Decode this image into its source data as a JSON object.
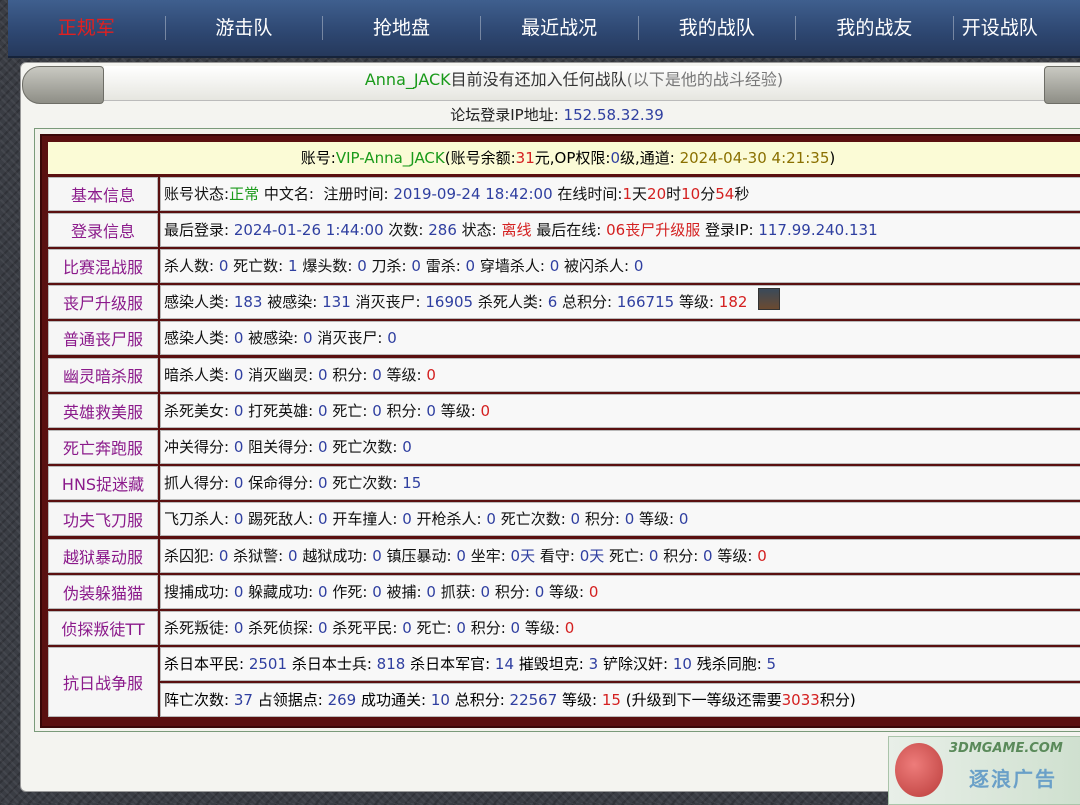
{
  "nav": [
    {
      "label": "正规军",
      "active": true
    },
    {
      "label": "游击队"
    },
    {
      "label": "抢地盘"
    },
    {
      "label": "最近战况"
    },
    {
      "label": "我的战队"
    },
    {
      "label": "我的战友"
    },
    {
      "label": "开设战队"
    }
  ],
  "header": {
    "name": "Anna_JACK",
    "msg": "目前没有还加入任何战队",
    "note": "(以下是他的战斗经验)"
  },
  "ip": {
    "label": "论坛登录IP地址:",
    "value": "152.58.32.39"
  },
  "account": {
    "label": "账号:",
    "value": "VIP-Anna_JACK",
    "bal_label": "(账号余额:",
    "balance": "31",
    "bal_unit": "元,OP权限:",
    "op": "0",
    "op_unit": "级,通道:",
    "date": "2024-04-30 4:21:35",
    "close": ")"
  },
  "basic": {
    "label": "基本信息",
    "status_label": "账号状态:",
    "status": "正常",
    "cname_label": "中文名:",
    "reg_label": "注册时间:",
    "reg": "2019-09-24 18:42:00",
    "online_label": "在线时间:",
    "d": "1",
    "d_u": "天",
    "h": "20",
    "h_u": "时",
    "m": "10",
    "m_u": "分",
    "s": "54",
    "s_u": "秒"
  },
  "login": {
    "label": "登录信息",
    "last_label": "最后登录:",
    "last": "2024-01-26 1:44:00",
    "count_label": "次数:",
    "count": "286",
    "state_label": "状态:",
    "state": "离线",
    "lastsrv_label": "最后在线:",
    "lastsrv": "06丧尸升级服",
    "ip_label": "登录IP:",
    "ip": "117.99.240.131"
  },
  "rows": [
    {
      "label": "比赛混战服",
      "items": [
        [
          "杀人数:",
          "0"
        ],
        [
          "死亡数:",
          "1"
        ],
        [
          "爆头数:",
          "0"
        ],
        [
          "刀杀:",
          "0"
        ],
        [
          "雷杀:",
          "0"
        ],
        [
          "穿墙杀人:",
          "0"
        ],
        [
          "被闪杀人:",
          "0"
        ]
      ]
    },
    {
      "label": "丧尸升级服",
      "items": [
        [
          "感染人类:",
          "183"
        ],
        [
          "被感染:",
          "131"
        ],
        [
          "消灭丧尸:",
          "16905"
        ],
        [
          "杀死人类:",
          "6"
        ],
        [
          "总积分:",
          "166715"
        ],
        [
          "等级:",
          "182",
          "red"
        ]
      ],
      "avatar": true
    },
    {
      "label": "普通丧尸服",
      "items": [
        [
          "感染人类:",
          "0"
        ],
        [
          "被感染:",
          "0"
        ],
        [
          "消灭丧尸:",
          "0"
        ]
      ]
    },
    {
      "label": "幽灵暗杀服",
      "items": [
        [
          "暗杀人类:",
          "0"
        ],
        [
          "消灭幽灵:",
          "0"
        ],
        [
          "积分:",
          "0"
        ],
        [
          "等级:",
          "0",
          "red"
        ]
      ]
    },
    {
      "label": "英雄救美服",
      "items": [
        [
          "杀死美女:",
          "0"
        ],
        [
          "打死英雄:",
          "0"
        ],
        [
          "死亡:",
          "0"
        ],
        [
          "积分:",
          "0"
        ],
        [
          "等级:",
          "0",
          "red"
        ]
      ]
    },
    {
      "label": "死亡奔跑服",
      "items": [
        [
          "冲关得分:",
          "0"
        ],
        [
          "阻关得分:",
          "0"
        ],
        [
          "死亡次数:",
          "0"
        ]
      ]
    },
    {
      "label": "HNS捉迷藏",
      "items": [
        [
          "抓人得分:",
          "0"
        ],
        [
          "保命得分:",
          "0"
        ],
        [
          "死亡次数:",
          "15"
        ]
      ]
    },
    {
      "label": "功夫飞刀服",
      "items": [
        [
          "飞刀杀人:",
          "0"
        ],
        [
          "踢死敌人:",
          "0"
        ],
        [
          "开车撞人:",
          "0"
        ],
        [
          "开枪杀人:",
          "0"
        ],
        [
          "死亡次数:",
          "0"
        ],
        [
          "积分:",
          "0"
        ],
        [
          "等级:",
          "0"
        ]
      ]
    },
    {
      "label": "越狱暴动服",
      "items": [
        [
          "杀囚犯:",
          "0"
        ],
        [
          "杀狱警:",
          "0"
        ],
        [
          "越狱成功:",
          "0"
        ],
        [
          "镇压暴动:",
          "0"
        ],
        [
          "坐牢:",
          "0天"
        ],
        [
          "看守:",
          "0天"
        ],
        [
          "死亡:",
          "0"
        ],
        [
          "积分:",
          "0"
        ],
        [
          "等级:",
          "0",
          "red"
        ]
      ]
    },
    {
      "label": "伪装躲猫猫",
      "items": [
        [
          "搜捕成功:",
          "0"
        ],
        [
          "躲藏成功:",
          "0"
        ],
        [
          "作死:",
          "0"
        ],
        [
          "被捕:",
          "0"
        ],
        [
          "抓获:",
          "0"
        ],
        [
          "积分:",
          "0"
        ],
        [
          "等级:",
          "0",
          "red"
        ]
      ]
    },
    {
      "label": "侦探叛徒TT",
      "items": [
        [
          "杀死叛徒:",
          "0"
        ],
        [
          "杀死侦探:",
          "0"
        ],
        [
          "杀死平民:",
          "0"
        ],
        [
          "死亡:",
          "0"
        ],
        [
          "积分:",
          "0"
        ],
        [
          "等级:",
          "0",
          "red"
        ]
      ]
    }
  ],
  "war": {
    "label": "抗日战争服",
    "line1": [
      [
        "杀日本平民:",
        "2501"
      ],
      [
        "杀日本士兵:",
        "818"
      ],
      [
        "杀日本军官:",
        "14"
      ],
      [
        "摧毁坦克:",
        "3"
      ],
      [
        "铲除汉奸:",
        "10"
      ],
      [
        "残杀同胞:",
        "5"
      ]
    ],
    "line2": [
      [
        "阵亡次数:",
        "37"
      ],
      [
        "占领据点:",
        "269"
      ],
      [
        "成功通关:",
        "10"
      ],
      [
        "总积分:",
        "22567"
      ],
      [
        "等级:",
        "15",
        "red"
      ]
    ],
    "next_pre": "(升级到下一等级还需要",
    "next_val": "3033",
    "next_post": "积分)"
  },
  "watermark": {
    "t1": "3DMGAME.COM",
    "t2": "逐浪广告"
  }
}
